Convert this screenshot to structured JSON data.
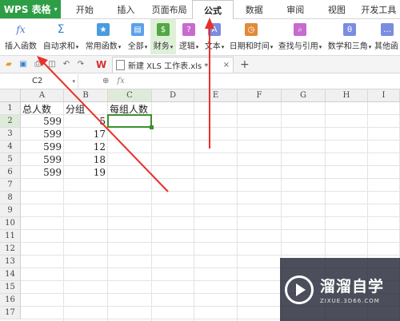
{
  "menubar": {
    "app_label": "WPS 表格",
    "tabs": [
      {
        "label": "开始",
        "active": false
      },
      {
        "label": "插入",
        "active": false
      },
      {
        "label": "页面布局",
        "active": false
      },
      {
        "label": "公式",
        "active": true
      },
      {
        "label": "数据",
        "active": false
      },
      {
        "label": "审阅",
        "active": false
      },
      {
        "label": "视图",
        "active": false
      },
      {
        "label": "开发工具",
        "active": false
      }
    ]
  },
  "ribbon": {
    "items": [
      {
        "label": "插入函数",
        "icon": "fx-icon",
        "dropdown": false
      },
      {
        "label": "自动求和",
        "icon": "sum-icon",
        "dropdown": true
      },
      {
        "label": "常用函数",
        "icon": "common-functions-icon",
        "dropdown": true
      },
      {
        "label": "全部",
        "icon": "all-functions-icon",
        "dropdown": true
      },
      {
        "label": "财务",
        "icon": "finance-icon",
        "dropdown": true
      },
      {
        "label": "逻辑",
        "icon": "logic-icon",
        "dropdown": true
      },
      {
        "label": "文本",
        "icon": "text-icon",
        "dropdown": true
      },
      {
        "label": "日期和时间",
        "icon": "datetime-icon",
        "dropdown": true
      },
      {
        "label": "查找与引用",
        "icon": "lookup-icon",
        "dropdown": true
      },
      {
        "label": "数学和三角",
        "icon": "math-icon",
        "dropdown": true
      },
      {
        "label": "其他函",
        "icon": "other-functions-icon",
        "dropdown": false
      }
    ]
  },
  "quickbar": {
    "wps_logo": "W",
    "file_tab": "新建 XLS 工作表.xls *",
    "close_glyph": "×",
    "new_tab_glyph": "+"
  },
  "formula_bar": {
    "cell_ref": "C2",
    "zoom_glyph": "⊕",
    "fx_label": "fx",
    "formula": ""
  },
  "sheet": {
    "columns": [
      "A",
      "B",
      "C",
      "D",
      "E",
      "F",
      "G",
      "H",
      "I"
    ],
    "rows": [
      "1",
      "2",
      "3",
      "4",
      "5",
      "6",
      "7",
      "8",
      "9",
      "10",
      "11",
      "12",
      "13",
      "14",
      "15",
      "16",
      "17"
    ],
    "selected_column": "C",
    "selected_row": "2",
    "headers": {
      "a": "总人数",
      "b": "分组",
      "c": "每组人数"
    },
    "data": [
      {
        "a": "599",
        "b": "5"
      },
      {
        "a": "599",
        "b": "17"
      },
      {
        "a": "599",
        "b": "12"
      },
      {
        "a": "599",
        "b": "18"
      },
      {
        "a": "599",
        "b": "19"
      }
    ]
  },
  "watermark": {
    "title": "溜溜自学",
    "url": "ZIXUE.3D66.COM"
  },
  "colors": {
    "brand_green": "#2e9e46",
    "selection_green": "#3e8e2f",
    "arrow_red": "#e8302a"
  }
}
